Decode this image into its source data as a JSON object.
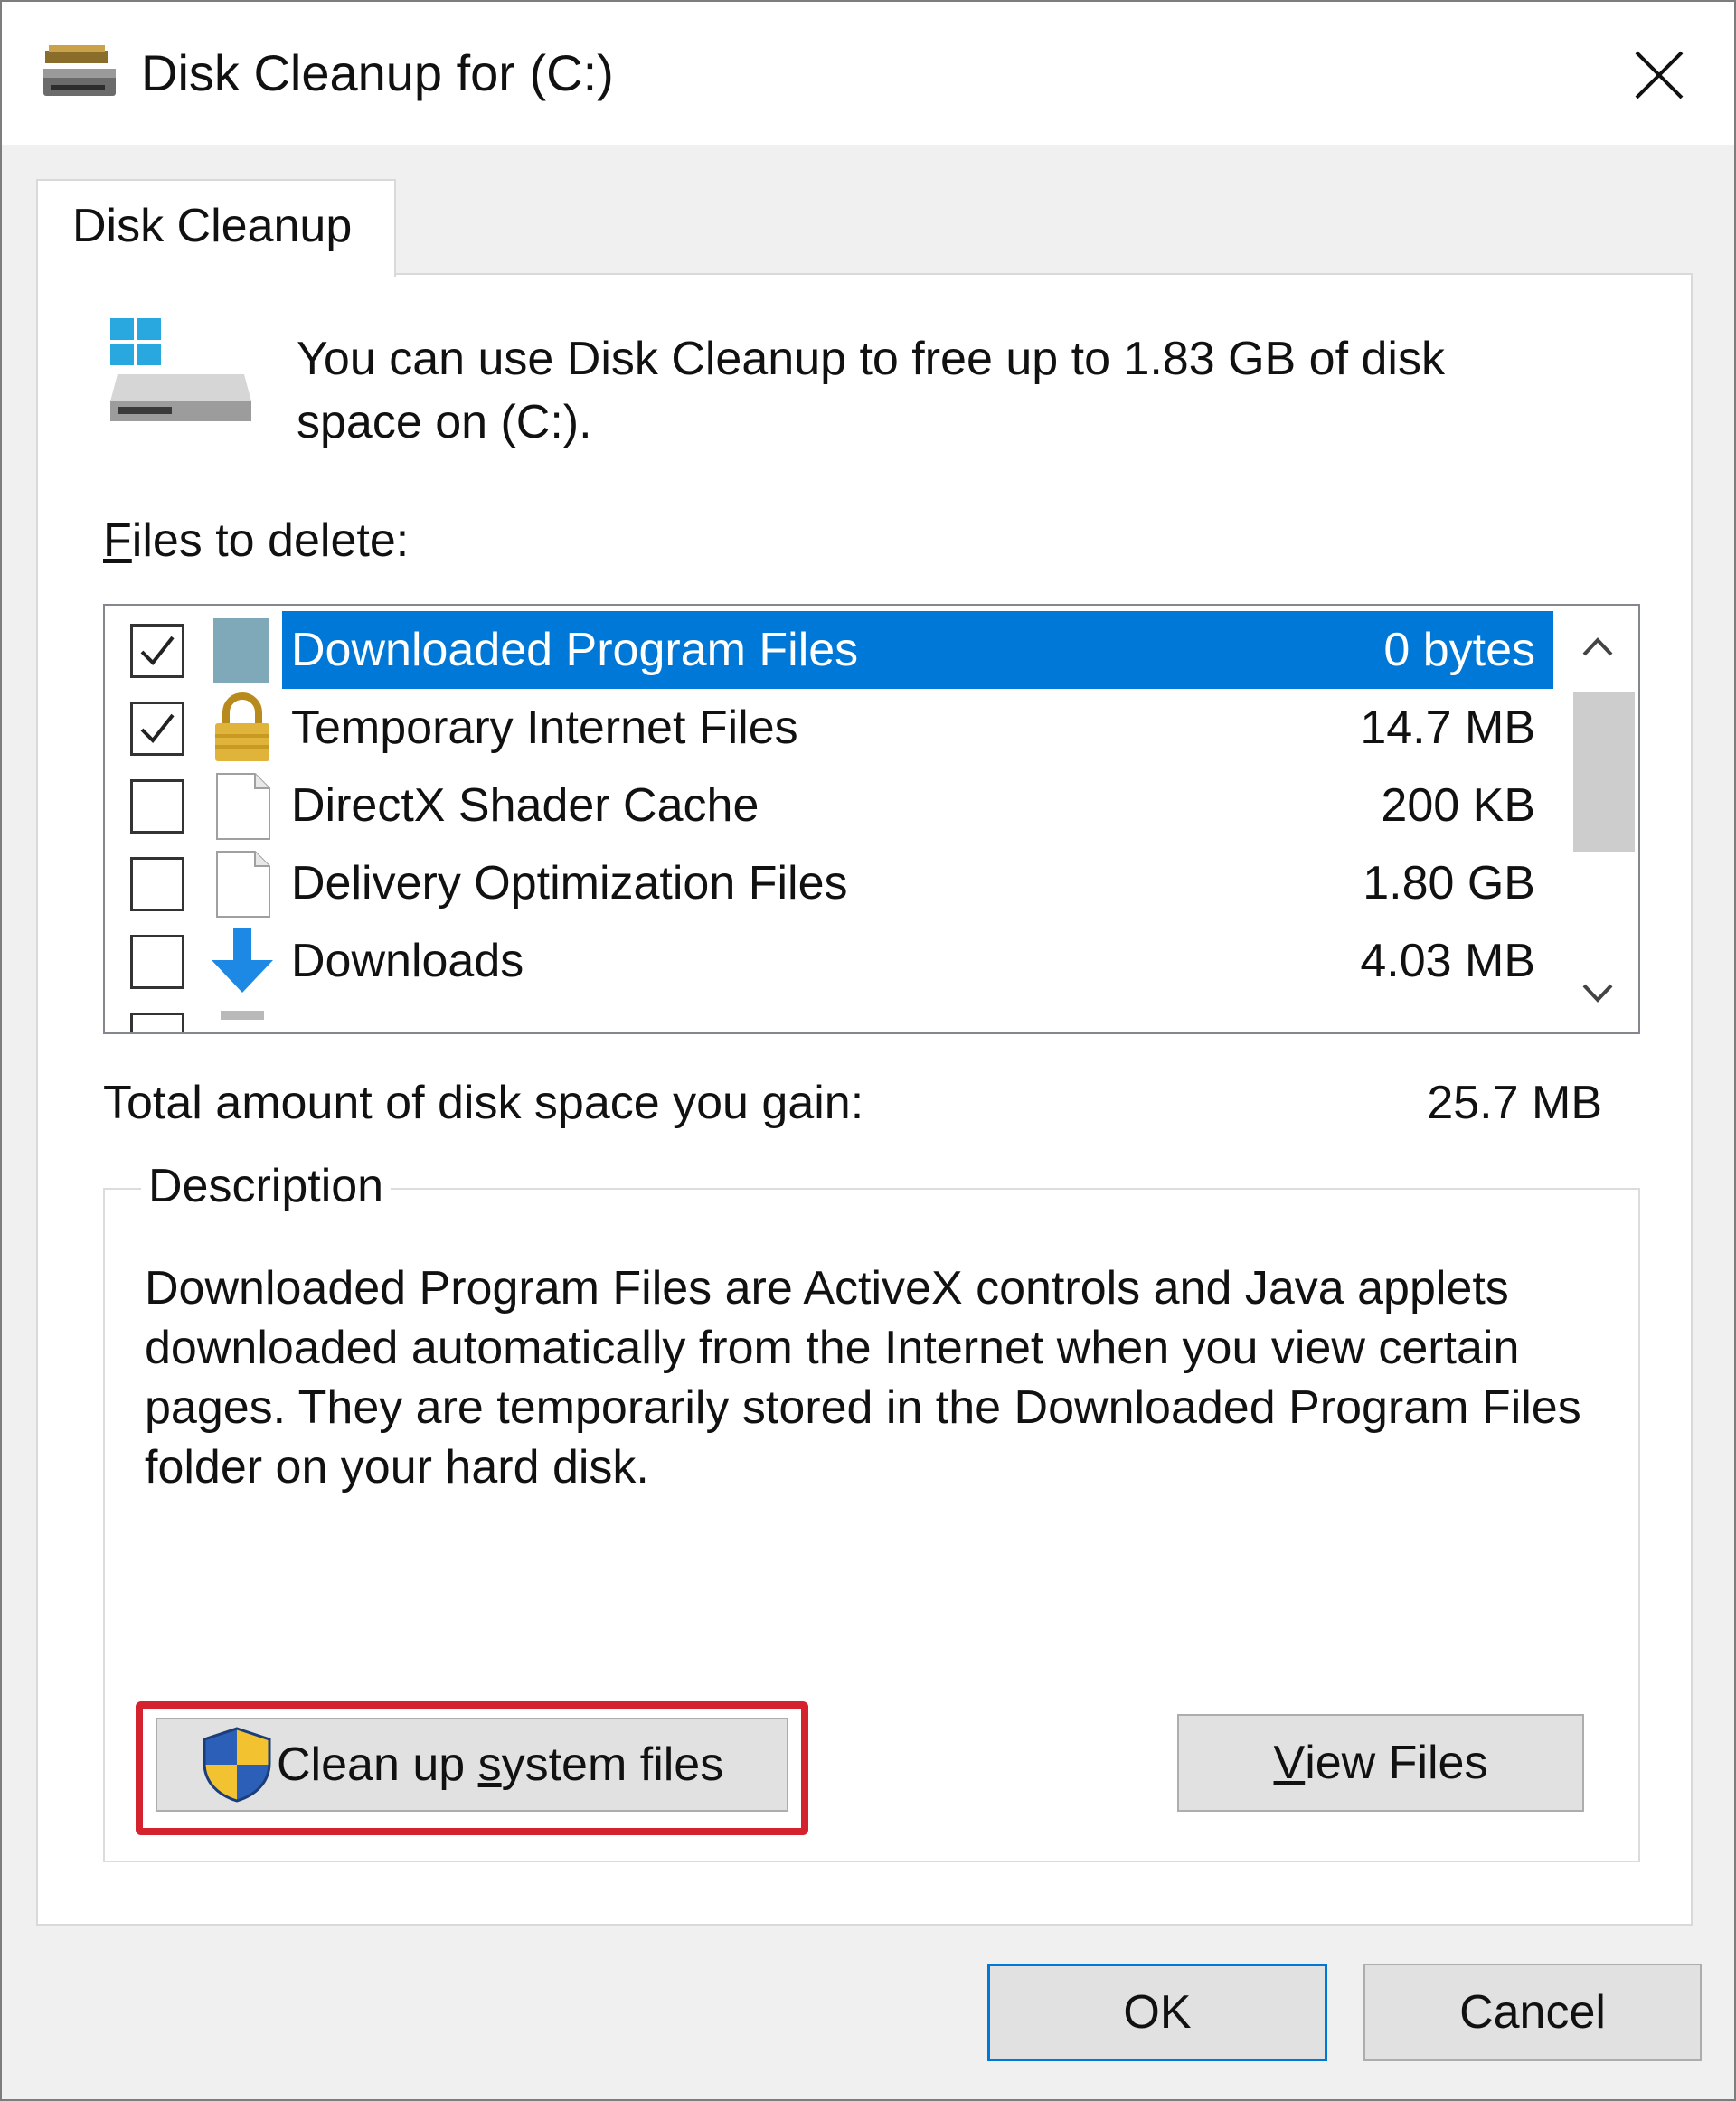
{
  "window": {
    "title": "Disk Cleanup for  (C:)",
    "close_icon": "close-icon"
  },
  "tabs": [
    {
      "label": "Disk Cleanup",
      "active": true
    }
  ],
  "intro": {
    "text": "You can use Disk Cleanup to free up to 1.83 GB of disk space on  (C:)."
  },
  "files_section": {
    "label_mnemonic": "F",
    "label_rest": "iles to delete:",
    "items": [
      {
        "name": "Downloaded Program Files",
        "size": "0 bytes",
        "checked": true,
        "selected": true,
        "icon": "folder-icon"
      },
      {
        "name": "Temporary Internet Files",
        "size": "14.7 MB",
        "checked": true,
        "selected": false,
        "icon": "lock-icon"
      },
      {
        "name": "DirectX Shader Cache",
        "size": "200 KB",
        "checked": false,
        "selected": false,
        "icon": "file-icon"
      },
      {
        "name": "Delivery Optimization Files",
        "size": "1.80 GB",
        "checked": false,
        "selected": false,
        "icon": "file-icon"
      },
      {
        "name": "Downloads",
        "size": "4.03 MB",
        "checked": false,
        "selected": false,
        "icon": "download-arrow-icon"
      }
    ]
  },
  "total": {
    "label": "Total amount of disk space you gain:",
    "value": "25.7 MB"
  },
  "description": {
    "legend": "Description",
    "text": "Downloaded Program Files are ActiveX controls and Java applets downloaded automatically from the Internet when you view certain pages. They are temporarily stored in the Downloaded Program Files folder on your hard disk."
  },
  "buttons": {
    "cleanup_pre": "Clean up ",
    "cleanup_mnemonic": "s",
    "cleanup_post": "ystem files",
    "view_mnemonic": "V",
    "view_rest": "iew Files",
    "ok": "OK",
    "cancel": "Cancel"
  },
  "colors": {
    "selection": "#0078d7",
    "highlight_outline": "#d5222f",
    "window_bg": "#f0f0f0"
  }
}
